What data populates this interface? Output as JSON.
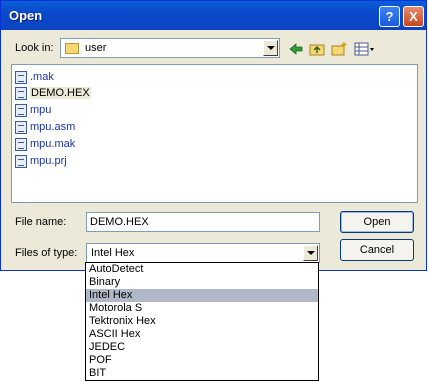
{
  "window": {
    "title": "Open"
  },
  "lookin": {
    "label": "Look in:",
    "value": "user"
  },
  "files": [
    {
      "name": ".mak",
      "selected": false
    },
    {
      "name": "DEMO.HEX",
      "selected": true
    },
    {
      "name": "mpu",
      "selected": false
    },
    {
      "name": "mpu.asm",
      "selected": false
    },
    {
      "name": "mpu.mak",
      "selected": false
    },
    {
      "name": "mpu.prj",
      "selected": false
    }
  ],
  "filename": {
    "label": "File name:",
    "value": "DEMO.HEX"
  },
  "filetype": {
    "label": "Files of type:",
    "value": "Intel Hex",
    "options": [
      "AutoDetect",
      "Binary",
      "Intel Hex",
      "Motorola S",
      "Tektronix Hex",
      "ASCII Hex",
      "JEDEC",
      "POF",
      "BIT"
    ],
    "selected_index": 2
  },
  "buttons": {
    "open": "Open",
    "cancel": "Cancel"
  },
  "title_buttons": {
    "help": "?",
    "close": "X"
  }
}
